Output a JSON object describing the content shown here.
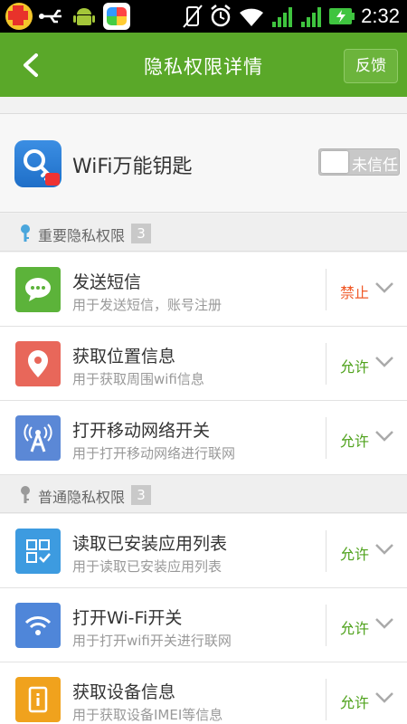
{
  "statusbar": {
    "time": "2:32"
  },
  "header": {
    "title": "隐私权限详情",
    "feedback": "反馈"
  },
  "app": {
    "name": "WiFi万能钥匙",
    "trust_label": "未信任"
  },
  "sections": [
    {
      "title": "重要隐私权限",
      "count": "3"
    },
    {
      "title": "普通隐私权限",
      "count": "3"
    }
  ],
  "permissions": [
    {
      "title": "发送短信",
      "desc": "用于发送短信，账号注册",
      "state": "禁止",
      "color": "#5cb33a"
    },
    {
      "title": "获取位置信息",
      "desc": "用于获取周围wifi信息",
      "state": "允许",
      "color": "#e8675a"
    },
    {
      "title": "打开移动网络开关",
      "desc": "用于打开移动网络进行联网",
      "state": "允许",
      "color": "#5b88d6"
    },
    {
      "title": "读取已安装应用列表",
      "desc": "用于读取已安装应用列表",
      "state": "允许",
      "color": "#3d9be0"
    },
    {
      "title": "打开Wi-Fi开关",
      "desc": "用于打开wifi开关进行联网",
      "state": "允许",
      "color": "#4f86d9"
    },
    {
      "title": "获取设备信息",
      "desc": "用于获取设备IMEI等信息",
      "state": "允许",
      "color": "#f0a21d"
    }
  ],
  "colors": {
    "header": "#5aa829",
    "allow": "#4fa21c",
    "deny": "#f05a28"
  }
}
